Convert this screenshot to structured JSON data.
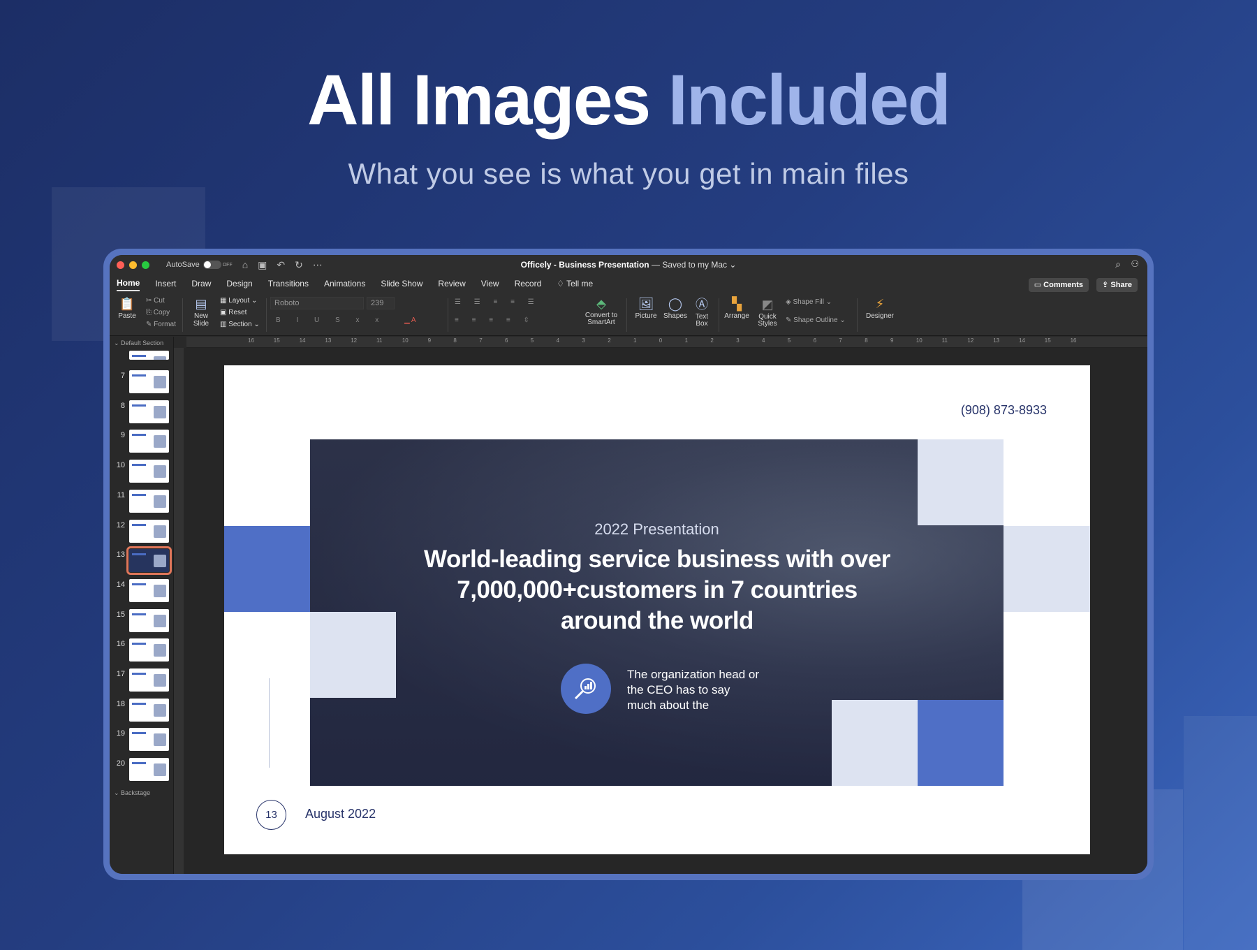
{
  "hero": {
    "title_main": "All Images",
    "title_highlight": "Included",
    "subtitle": "What you see is what you get in main files"
  },
  "titlebar": {
    "autosave_label": "AutoSave",
    "autosave_state": "OFF",
    "doc_name": "Officely - Business Presentation",
    "doc_status": "— Saved to my Mac"
  },
  "tabs": [
    "Home",
    "Insert",
    "Draw",
    "Design",
    "Transitions",
    "Animations",
    "Slide Show",
    "Review",
    "View",
    "Record"
  ],
  "tell_me": "Tell me",
  "actions": {
    "comments": "Comments",
    "share": "Share"
  },
  "ribbon": {
    "paste": "Paste",
    "cut": "Cut",
    "copy": "Copy",
    "format": "Format",
    "new_slide": "New Slide",
    "layout": "Layout",
    "reset": "Reset",
    "section": "Section",
    "font_name": "Roboto",
    "font_size": "239",
    "convert_smartart": "Convert to SmartArt",
    "picture": "Picture",
    "shapes": "Shapes",
    "text_box": "Text Box",
    "arrange": "Arrange",
    "quick_styles": "Quick Styles",
    "shape_fill": "Shape Fill",
    "shape_outline": "Shape Outline",
    "designer": "Designer"
  },
  "ruler_ticks": [
    "16",
    "15",
    "14",
    "13",
    "12",
    "11",
    "10",
    "9",
    "8",
    "7",
    "6",
    "5",
    "4",
    "3",
    "2",
    "1",
    "0",
    "1",
    "2",
    "3",
    "4",
    "5",
    "6",
    "7",
    "8",
    "9",
    "10",
    "11",
    "12",
    "13",
    "14",
    "15",
    "16"
  ],
  "sidebar": {
    "section_top": "Default Section",
    "section_bottom": "Backstage",
    "slides": [
      "7",
      "8",
      "9",
      "10",
      "11",
      "12",
      "13",
      "14",
      "15",
      "16",
      "17",
      "18",
      "19",
      "20"
    ],
    "selected": "13"
  },
  "slide": {
    "phone": "(908) 873-8933",
    "subtitle": "2022 Presentation",
    "title": "World-leading service business with over 7,000,000+customers in 7 countries around the world",
    "body": "The organization head or the CEO has to say much about the",
    "page_number": "13",
    "date": "August 2022"
  },
  "colors": {
    "accent": "#4f6fc6",
    "light_block": "#dde3f1",
    "navy_text": "#28346a",
    "highlight": "#9fb4ea"
  },
  "icons": {
    "slide_icon": "search-chart-icon"
  }
}
